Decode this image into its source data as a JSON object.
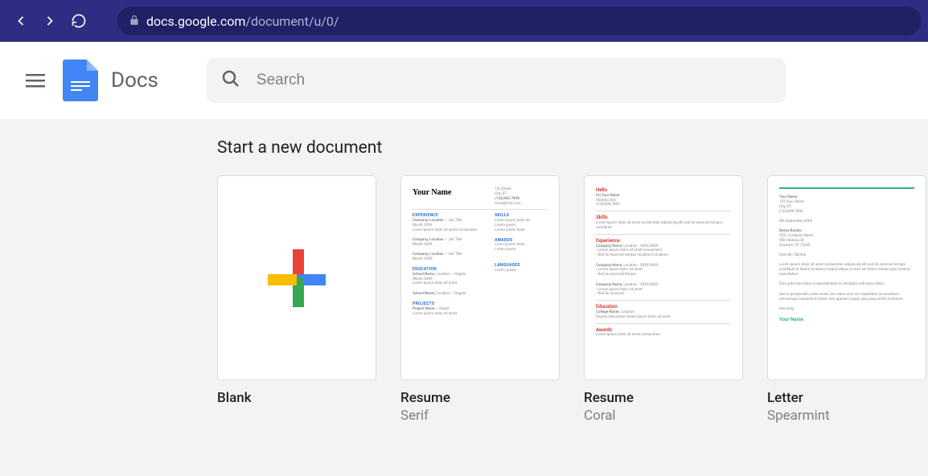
{
  "browser": {
    "url_host": "docs.google.com",
    "url_path": "/document/u/0/"
  },
  "header": {
    "app_name": "Docs",
    "search_placeholder": "Search"
  },
  "gallery": {
    "title": "Start a new document",
    "templates": [
      {
        "title": "Blank",
        "subtitle": ""
      },
      {
        "title": "Resume",
        "subtitle": "Serif"
      },
      {
        "title": "Resume",
        "subtitle": "Coral"
      },
      {
        "title": "Letter",
        "subtitle": "Spearmint"
      }
    ]
  }
}
